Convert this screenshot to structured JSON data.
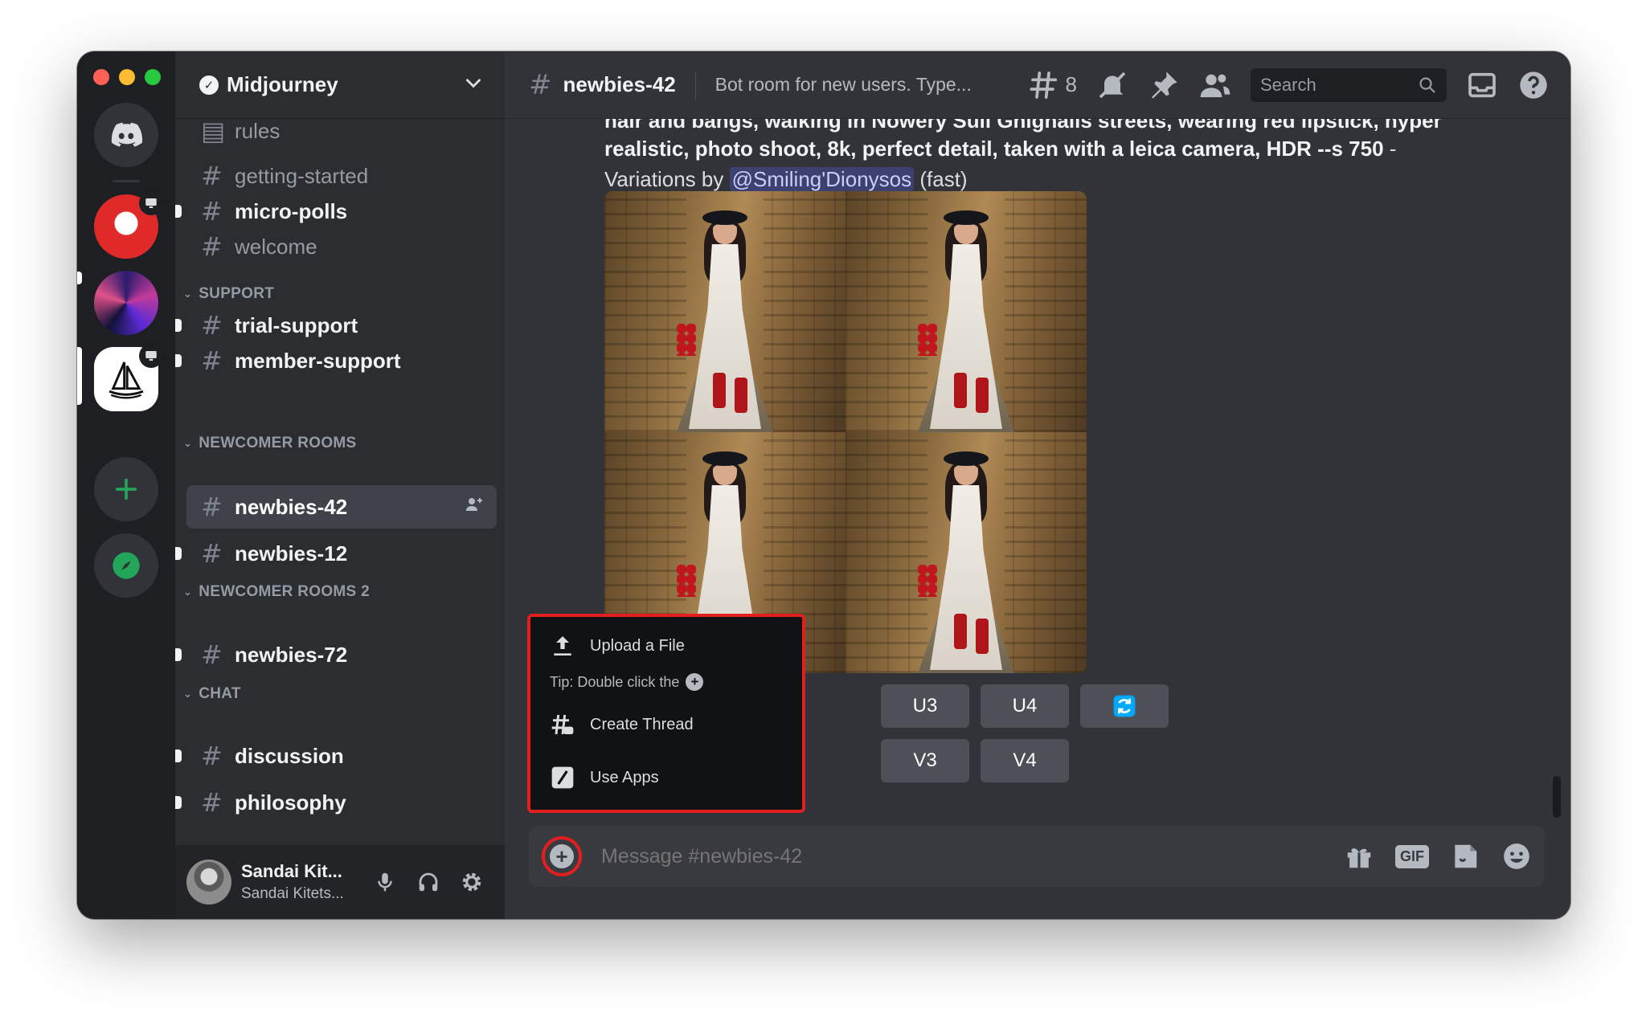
{
  "server": {
    "name": "Midjourney"
  },
  "channels": {
    "partial_top": "rules",
    "list": [
      {
        "name": "getting-started"
      },
      {
        "name": "micro-polls"
      },
      {
        "name": "welcome"
      },
      {
        "name": "trial-support"
      },
      {
        "name": "member-support"
      },
      {
        "name": "newbies-42"
      },
      {
        "name": "newbies-12"
      },
      {
        "name": "newbies-72"
      },
      {
        "name": "discussion"
      },
      {
        "name": "philosophy"
      }
    ],
    "categories": [
      "SUPPORT",
      "NEWCOMER ROOMS",
      "NEWCOMER ROOMS 2",
      "CHAT"
    ]
  },
  "user": {
    "display_name": "Sandai Kit...",
    "username": "Sandai Kitets..."
  },
  "topbar": {
    "channel": "newbies-42",
    "topic": "Bot room for new users. Type...",
    "threads_count": "8",
    "search_placeholder": "Search"
  },
  "message": {
    "line_clipped": "hair and bangs, walking in Nowery Sull Ghighalls streets, wearing red lipstick, hyper",
    "line_bold": "realistic, photo shoot, 8k, perfect detail, taken with a leica camera, HDR --s 750",
    "line_dash": " -",
    "variations_prefix": "Variations by ",
    "mention": "@Smiling'Dionysos",
    "suffix": " (fast)"
  },
  "buttons": {
    "row1": [
      "U3",
      "U4"
    ],
    "row2": [
      "V3",
      "V4"
    ]
  },
  "attach_menu": {
    "upload": "Upload a File",
    "tip": "Tip: Double click the",
    "thread": "Create Thread",
    "apps": "Use Apps"
  },
  "composer": {
    "placeholder": "Message #newbies-42",
    "gif": "GIF"
  },
  "colors": {
    "accent": "#5865f2",
    "highlight": "#e21e1e",
    "green": "#23a55a"
  }
}
